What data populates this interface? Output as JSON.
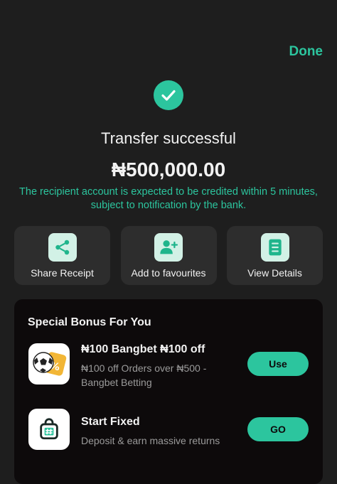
{
  "theme": {
    "accent": "#2cc59e"
  },
  "header": {
    "done_label": "Done"
  },
  "status": {
    "icon": "check-circle-icon",
    "title": "Transfer successful",
    "amount": "₦500,000.00",
    "notice": "The recipient account is expected to be credited within 5 minutes, subject to notification by the bank."
  },
  "actions": [
    {
      "label": "Share Receipt",
      "icon": "share-icon"
    },
    {
      "label": "Add to favourites",
      "icon": "add-user-icon"
    },
    {
      "label": "View Details",
      "icon": "list-document-icon"
    }
  ],
  "bonus": {
    "title": "Special Bonus For You",
    "offers": [
      {
        "title": "₦100 Bangbet ₦100 off",
        "description": "₦100 off Orders over ₦500 - Bangbet Betting",
        "button": "Use",
        "icon": "bangbet-logo"
      },
      {
        "title": "Start Fixed",
        "description": "Deposit & earn massive returns",
        "button": "GO",
        "icon": "fixed-savings-bag-icon"
      }
    ]
  }
}
